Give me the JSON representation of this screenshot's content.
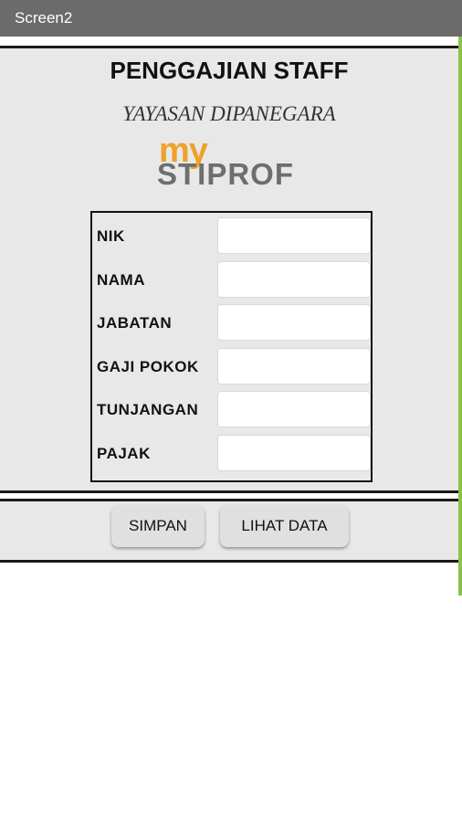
{
  "app": {
    "screen_title": "Screen2"
  },
  "header": {
    "title": "PENGGAJIAN STAFF",
    "subtitle": "YAYASAN DIPANEGARA"
  },
  "logo": {
    "top_text": "my",
    "bottom_text": "STIPROF"
  },
  "form": {
    "fields": [
      {
        "label": "NIK",
        "value": ""
      },
      {
        "label": "NAMA",
        "value": ""
      },
      {
        "label": "JABATAN",
        "value": ""
      },
      {
        "label": "GAJI POKOK",
        "value": ""
      },
      {
        "label": "TUNJANGAN",
        "value": ""
      },
      {
        "label": "PAJAK",
        "value": ""
      }
    ]
  },
  "actions": {
    "save_label": "SIMPAN",
    "view_label": "LIHAT DATA"
  },
  "colors": {
    "titlebar": "#6b6b6b",
    "accent_green": "#8bc34a",
    "logo_orange": "#f0a12a",
    "logo_gray": "#6e6e6e",
    "panel": "#e8e8e8"
  }
}
